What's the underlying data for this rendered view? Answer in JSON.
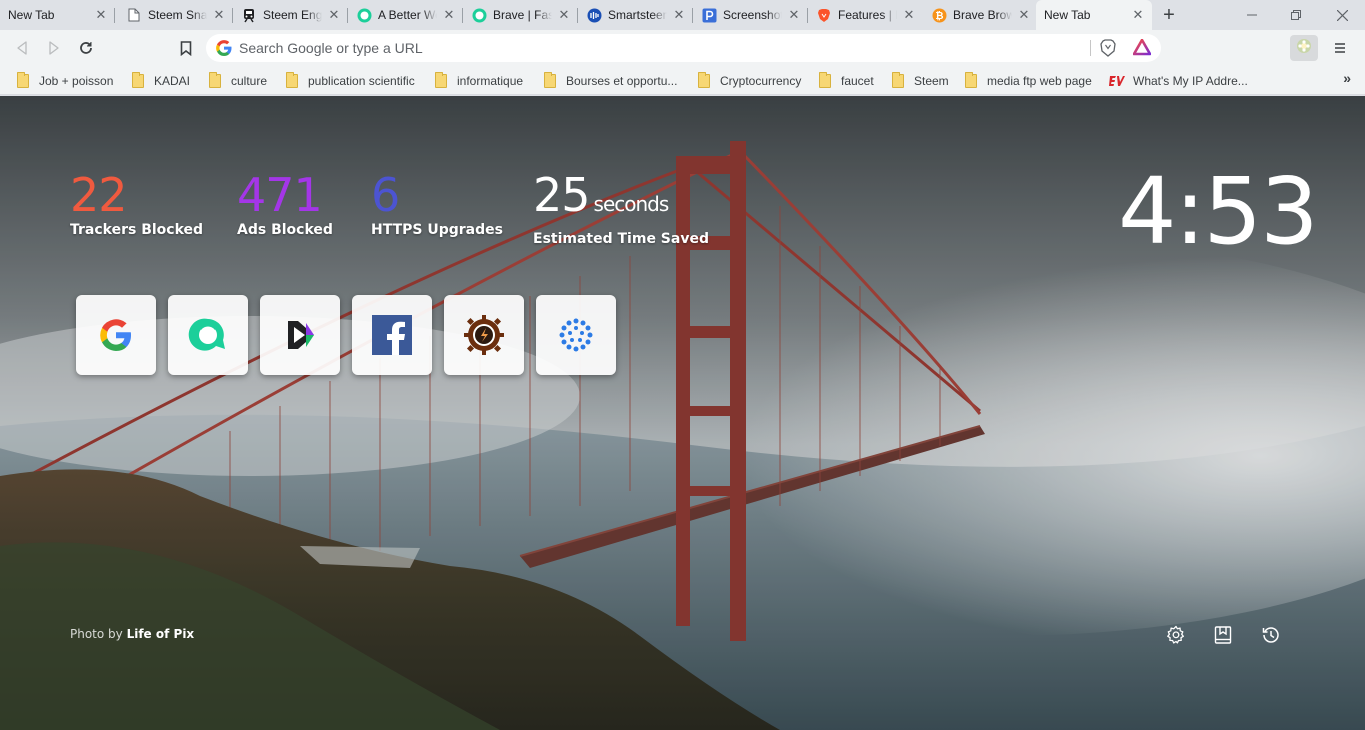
{
  "tabs": [
    {
      "title": "New Tab",
      "favicon": "none"
    },
    {
      "title": "Steem Snaps",
      "favicon": "document-icon"
    },
    {
      "title": "Steem Engine",
      "favicon": "train-icon"
    },
    {
      "title": "A Better Web",
      "favicon": "brave-chat-icon"
    },
    {
      "title": "Brave | Fast",
      "favicon": "brave-chat-icon"
    },
    {
      "title": "Smartsteem",
      "favicon": "smartsteem-icon"
    },
    {
      "title": "Screenshot",
      "favicon": "p-icon"
    },
    {
      "title": "Features | Brave",
      "favicon": "brave-lion-icon"
    },
    {
      "title": "Brave Browser",
      "favicon": "bitcoin-icon"
    },
    {
      "title": "New Tab",
      "favicon": "none",
      "active": true
    }
  ],
  "omnibox": {
    "placeholder": "Search Google or type a URL",
    "value": ""
  },
  "bookmarks": [
    {
      "label": "Job + poisson",
      "type": "folder"
    },
    {
      "label": "KADAI",
      "type": "folder"
    },
    {
      "label": "culture",
      "type": "folder"
    },
    {
      "label": "publication scientific",
      "type": "folder"
    },
    {
      "label": "informatique",
      "type": "folder"
    },
    {
      "label": "Bourses et opportu...",
      "type": "folder"
    },
    {
      "label": "Cryptocurrency",
      "type": "folder"
    },
    {
      "label": "faucet",
      "type": "folder"
    },
    {
      "label": "Steem",
      "type": "folder"
    },
    {
      "label": "media ftp web page",
      "type": "folder"
    },
    {
      "label": "What's My IP Addre...",
      "type": "link"
    }
  ],
  "bookmarks_overflow": "»",
  "stats": [
    {
      "value": "22",
      "label": "Trackers Blocked",
      "color": "#f05a3f"
    },
    {
      "value": "471",
      "label": "Ads Blocked",
      "color": "#a436e8"
    },
    {
      "value": "6",
      "label": "HTTPS Upgrades",
      "color": "#4c54d2"
    },
    {
      "value": "25",
      "unit": "seconds",
      "label": "Estimated Time Saved",
      "color": "#ffffff"
    }
  ],
  "clock": "4:53",
  "top_sites": [
    {
      "name": "google",
      "icon": "google-icon"
    },
    {
      "name": "steemchat",
      "icon": "chat-bubble-icon"
    },
    {
      "name": "dtube",
      "icon": "play-icon"
    },
    {
      "name": "facebook",
      "icon": "facebook-icon"
    },
    {
      "name": "steemengine",
      "icon": "gear-logo-icon"
    },
    {
      "name": "smartsteem",
      "icon": "dots-circle-icon"
    }
  ],
  "photo_credit": {
    "prefix": "Photo by ",
    "author": "Life of Pix"
  },
  "colors": {
    "tab_strip": "#dee1e6",
    "toolbar": "#f1f3f4",
    "brave_orange": "#fb542b"
  }
}
